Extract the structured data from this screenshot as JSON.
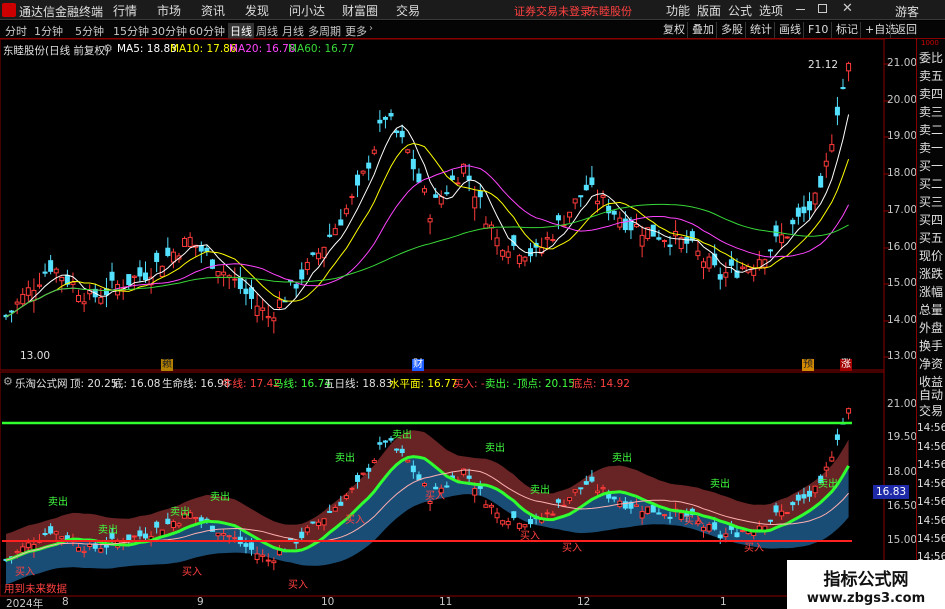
{
  "app": {
    "title": "通达信金融终端",
    "menus": [
      "行情",
      "市场",
      "资讯",
      "发现",
      "问小达",
      "财富圈",
      "交易"
    ],
    "notice": "证券交易未登录",
    "stock_short": "东睦股份",
    "right_menus": [
      "功能",
      "版面",
      "公式",
      "选项"
    ],
    "user": "游客"
  },
  "period_tabs": [
    "分时",
    "1分钟",
    "5分钟",
    "15分钟",
    "30分钟",
    "60分钟",
    "日线",
    "周线",
    "月线",
    "多周期",
    "更多"
  ],
  "active_period": "日线",
  "toolbar": [
    "复权",
    "叠加",
    "多股",
    "统计",
    "画线",
    "F10",
    "标记",
    "+自选",
    "返回"
  ],
  "main_header": {
    "name": "东睦股份(日线 前复权)",
    "ma5": "MA5: 18.83",
    "ma10": "MA10: 17.86",
    "ma20": "MA20: 16.78",
    "ma60": "MA60: 16.77"
  },
  "price_axis": [
    "21.00",
    "20.00",
    "19.00",
    "18.00",
    "17.00",
    "16.00",
    "15.00",
    "14.00",
    "13.00"
  ],
  "annotations": {
    "high": "21.12",
    "low": "13.00",
    "event_a": "赖",
    "event_b": "财",
    "event_c": "预",
    "event_d": "涨"
  },
  "sub_header": {
    "name": "乐淘公式网",
    "top": "顶: 20.25",
    "bottom": "底: 16.08",
    "life": "生命线: 16.98",
    "cow": "牛线: 17.42",
    "horse": "马线: 16.74",
    "ma5": "五日线: 18.83",
    "level": "水平面: 16.77",
    "buy": "买入: -",
    "sell": "卖出: -",
    "peak": "顶点: 20.15",
    "trough": "底点: 14.92"
  },
  "sub_axis": [
    "21.00",
    "19.50",
    "18.00",
    "16.50",
    "15.00"
  ],
  "sub_badge": "16.83",
  "sub_labels": {
    "sell": "卖出",
    "buy": "买入",
    "future": "用到未来数据"
  },
  "dates": [
    "2024年",
    "8",
    "9",
    "10",
    "11",
    "12",
    "1"
  ],
  "side_top": [
    "委比",
    "卖五",
    "卖四",
    "卖三",
    "卖二",
    "卖一",
    "买一",
    "买二",
    "买三",
    "买四",
    "买五",
    "现价",
    "涨跌",
    "涨幅",
    "总量",
    "外盘",
    "换手",
    "净资",
    "收益"
  ],
  "side_bottom": [
    "自动",
    "交易",
    "14:56",
    "14:56",
    "14:56",
    "14:56",
    "14:56",
    "14:56",
    "14:56",
    "14:56",
    "14:56"
  ],
  "side_small": "1000",
  "watermark": {
    "title": "指标公式网",
    "url": "www.zbgs3.com"
  },
  "colors": {
    "up": "#ff3b3b",
    "down": "#54e0ff",
    "ma5": "#ffffff",
    "ma10": "#ffff00",
    "ma20": "#ff44ff",
    "ma60": "#38d838",
    "green_line": "#30ff30",
    "red_line": "#ff2020"
  }
}
